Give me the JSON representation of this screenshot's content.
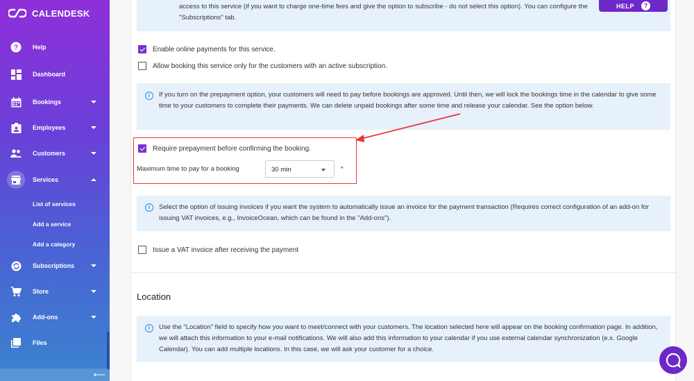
{
  "app": {
    "name": "CALENDESK"
  },
  "sidebar": {
    "items": [
      {
        "label": "Help",
        "icon": "help-icon"
      },
      {
        "label": "Dashboard",
        "icon": "dashboard-icon"
      },
      {
        "label": "Bookings",
        "icon": "calendar-icon"
      },
      {
        "label": "Employees",
        "icon": "employee-badge-icon"
      },
      {
        "label": "Customers",
        "icon": "people-icon"
      },
      {
        "label": "Services",
        "icon": "storefront-icon"
      },
      {
        "label": "Subscriptions",
        "icon": "subscriptions-icon"
      },
      {
        "label": "Store",
        "icon": "cart-icon"
      },
      {
        "label": "Add-ons",
        "icon": "puzzle-icon"
      },
      {
        "label": "Files",
        "icon": "files-icon"
      }
    ],
    "services_sub": [
      "List of services",
      "Add a service",
      "Add a category"
    ],
    "collapse_icon": "arrow-left-icon"
  },
  "help_button": {
    "label": "HELP",
    "icon": "question-icon"
  },
  "top_info": "access to this service (if you want to charge one-time fees and give the option to subscribe - do not select this option). You can configure the \"Subscriptions\" tab.",
  "checkboxes": {
    "online_payments": {
      "label": "Enable online payments for this service.",
      "checked": true
    },
    "subscription_only": {
      "label": "Allow booking this service only for the customers with an active subscription.",
      "checked": false
    },
    "prepayment": {
      "label": "Require prepayment before confirming the booking.",
      "checked": true
    },
    "vat_invoice": {
      "label": "Issue a VAT invoice after receiving the payment",
      "checked": false
    }
  },
  "prepayment_info": "If you turn on the prepayment option, your customers will need to pay before bookings are approved. Until then, we will lock the bookings time in the calendar to give some time to your customers to complete their payments. We can delete unpaid bookings after some time and release your calendar. See the option below.",
  "max_time": {
    "label": "Maximum time to pay for a booking",
    "value": "30 min",
    "required": "*"
  },
  "invoice_info": "Select the option of issuing invoices if you want the system to automatically issue an invoice for the payment transaction (Requires correct configuration of an add-on for issuing VAT invoices, e.g., InvoiceOcean, which can be found in the \"Add-ons\").",
  "location": {
    "title": "Location",
    "info": "Use the \"Location\" field to specify how you want to meet/connect with your customers. The location selected here will appear on the booking confirmation page. In addition, we will attach this information to your e-mail notifications. We will also add this information to your calendar if you use external calendar synchronization (e.x. Google Calendar). You can add multiple locations. In this case, we will ask your customer for a choice."
  },
  "colors": {
    "accent": "#7b2fd0",
    "highlight": "#e53935",
    "info_bg": "#e6f1fb"
  }
}
